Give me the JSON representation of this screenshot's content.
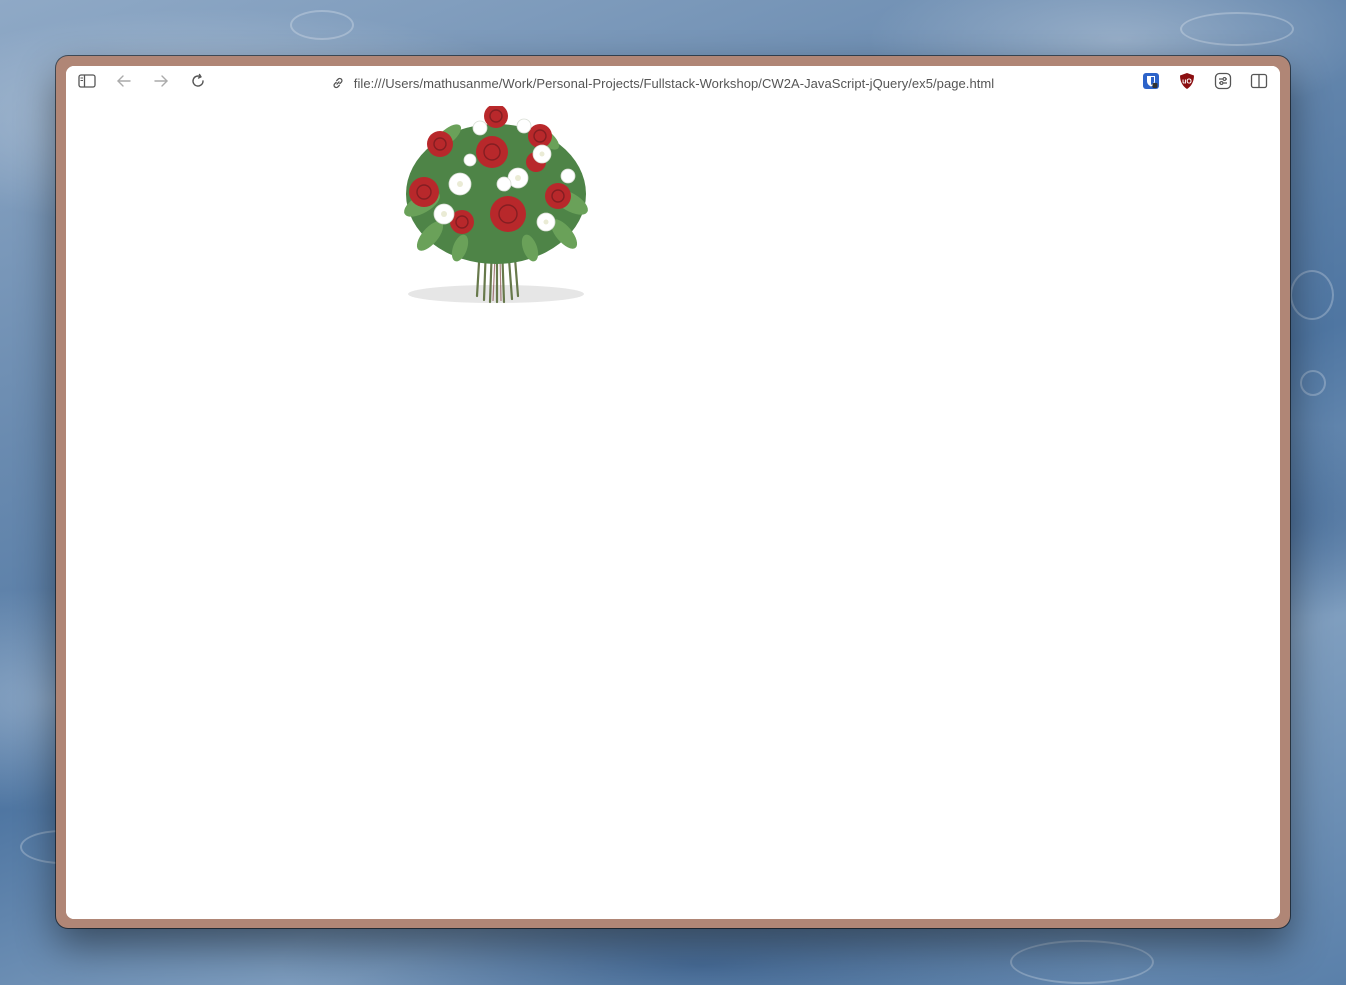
{
  "browser": {
    "url": "file:///Users/mathusanme/Work/Personal-Projects/Fullstack-Workshop/CW2A-JavaScript-jQuery/ex5/page.html",
    "toolbar": {
      "left_icons": [
        "sidebar-icon",
        "back-arrow-icon",
        "forward-arrow-icon",
        "reload-icon"
      ],
      "right_icons": [
        "bitwarden-extension-icon",
        "ublock-origin-extension-icon",
        "tab-settings-icon",
        "split-view-icon"
      ]
    }
  },
  "page": {
    "image": "bouquet of red roses and white flowers"
  },
  "colors": {
    "window_frame": "#b08676",
    "toolbar_text": "#555555",
    "rose_red": "#b3161a",
    "ublock_red": "#8b0e10",
    "bitwarden_blue": "#2d63c9"
  }
}
